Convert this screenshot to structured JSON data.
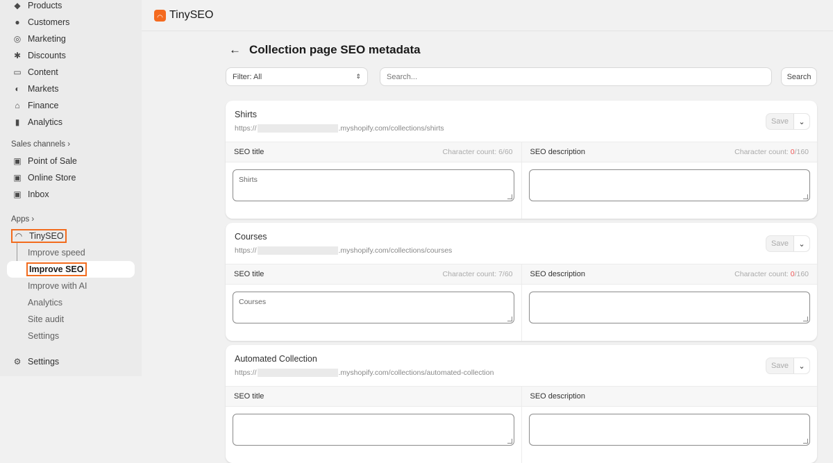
{
  "sidebar": {
    "items": [
      {
        "label": "Products",
        "icon": "tag-icon"
      },
      {
        "label": "Customers",
        "icon": "person-icon"
      },
      {
        "label": "Marketing",
        "icon": "target-icon"
      },
      {
        "label": "Discounts",
        "icon": "discount-icon"
      },
      {
        "label": "Content",
        "icon": "content-icon"
      },
      {
        "label": "Markets",
        "icon": "globe-icon"
      },
      {
        "label": "Finance",
        "icon": "bank-icon"
      },
      {
        "label": "Analytics",
        "icon": "bar-chart-icon"
      }
    ],
    "sales_channels_label": "Sales channels",
    "channels": [
      {
        "label": "Point of Sale"
      },
      {
        "label": "Online Store"
      },
      {
        "label": "Inbox"
      }
    ],
    "apps_label": "Apps",
    "app_name": "TinySEO",
    "app_items": [
      "Improve speed",
      "Improve SEO",
      "Improve with AI",
      "Analytics",
      "Site audit",
      "Settings"
    ],
    "settings_label": "Settings"
  },
  "header": {
    "app_title": "TinySEO"
  },
  "page": {
    "title": "Collection page SEO metadata",
    "filter_value": "Filter: All",
    "search_placeholder": "Search...",
    "search_button": "Search"
  },
  "labels": {
    "seo_title": "SEO title",
    "seo_description": "SEO description",
    "char_count": "Character count: ",
    "save": "Save",
    "url_prefix": "https://"
  },
  "cards": [
    {
      "name": "Shirts",
      "url_suffix": ".myshopify.com/collections/shirts",
      "title_count": "6/60",
      "desc_count_current": "0",
      "desc_count_max": "/160",
      "seo_title": "Shirts",
      "seo_description": ""
    },
    {
      "name": "Courses",
      "url_suffix": ".myshopify.com/collections/courses",
      "title_count": "7/60",
      "desc_count_current": "0",
      "desc_count_max": "/160",
      "seo_title": "Courses",
      "seo_description": ""
    },
    {
      "name": "Automated Collection",
      "url_suffix": ".myshopify.com/collections/automated-collection",
      "title_count": "",
      "desc_count_current": "",
      "desc_count_max": "",
      "seo_title": "",
      "seo_description": ""
    }
  ]
}
